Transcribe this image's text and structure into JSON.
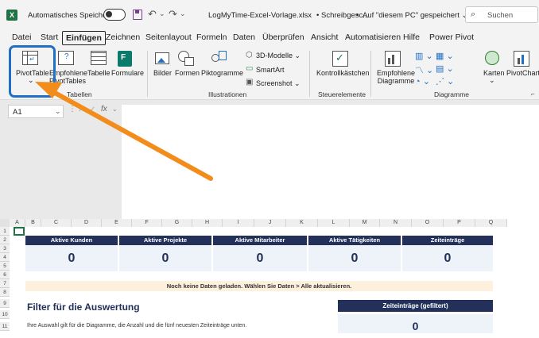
{
  "titlebar": {
    "autosave_label": "Automatisches Speichern",
    "filename": "LogMyTime-Excel-Vorlage.xlsx",
    "protection": "Schreibgesc...",
    "saved_state": "Auf \"diesem PC\" gespeichert",
    "search_placeholder": "Suchen"
  },
  "menu": [
    "Datei",
    "Start",
    "Einfügen",
    "Zeichnen",
    "Seitenlayout",
    "Formeln",
    "Daten",
    "Überprüfen",
    "Ansicht",
    "Automatisieren",
    "Hilfe",
    "Power Pivot"
  ],
  "ribbon": {
    "pivottable": "PivotTable",
    "pivottable_arrow": "⌄",
    "empf_pivot_1": "Empfohlene",
    "empf_pivot_2": "PivotTables",
    "tabelle": "Tabelle",
    "formulare": "Formulare",
    "group_tabellen": "Tabellen",
    "bilder": "Bilder",
    "formen": "Formen",
    "piktogramme": "Piktogramme",
    "modelle_3d": "3D-Modelle",
    "smartart": "SmartArt",
    "screenshot": "Screenshot",
    "group_illustrationen": "Illustrationen",
    "kontrollkaestchen": "Kontrollkästchen",
    "group_steuerelemente": "Steuerelemente",
    "empf_diagramme_1": "Empfohlene",
    "empf_diagramme_2": "Diagramme",
    "karten": "Karten",
    "pivotchart": "PivotChart",
    "group_diagramme": "Diagramme"
  },
  "formula": {
    "namebox": "A1",
    "fx": "fx"
  },
  "columns": [
    "A",
    "B",
    "C",
    "D",
    "E",
    "F",
    "G",
    "H",
    "I",
    "J",
    "K",
    "L",
    "M",
    "N",
    "O",
    "P",
    "Q"
  ],
  "rows": [
    "1",
    "2",
    "3",
    "4",
    "5",
    "6",
    "7",
    "8",
    "9",
    "10",
    "11"
  ],
  "kpis": [
    {
      "label": "Aktive Kunden",
      "value": "0"
    },
    {
      "label": "Aktive Projekte",
      "value": "0"
    },
    {
      "label": "Aktive Mitarbeiter",
      "value": "0"
    },
    {
      "label": "Aktive Tätigkeiten",
      "value": "0"
    },
    {
      "label": "Zeiteinträge",
      "value": "0"
    }
  ],
  "notice": "Noch keine Daten geladen. Wählen Sie Daten > Alle aktualisieren.",
  "filter": {
    "title": "Filter für die Auswertung",
    "hint": "Ihre Auswahl gilt für die Diagramme, die Anzahl und die fünf neuesten Zeiteinträge unten."
  },
  "filtered": {
    "label": "Zeiteinträge (gefiltert)",
    "value": "0"
  },
  "colors": {
    "accent": "#22305a",
    "highlight": "#1f6fc5",
    "arrow": "#f28c1b",
    "excel_green": "#217346"
  }
}
